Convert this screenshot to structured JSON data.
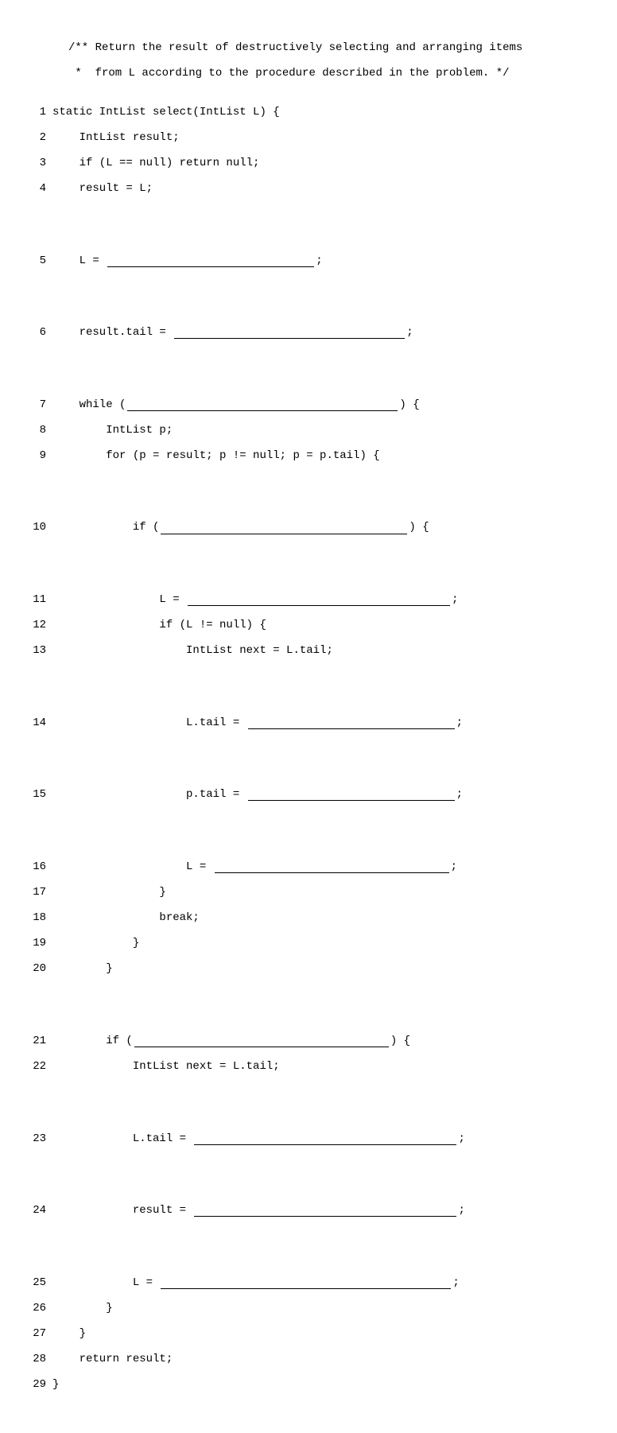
{
  "comment1": "/** Return the result of destructively selecting and arranging items",
  "comment2": " *  from L according to the procedure described in the problem. */",
  "l1": {
    "n": "1",
    "c": "static IntList select(IntList L) {"
  },
  "l2": {
    "n": "2",
    "c": "    IntList result;"
  },
  "l3": {
    "n": "3",
    "c": "    if (L == null) return null;"
  },
  "l4": {
    "n": "4",
    "c": "    result = L;"
  },
  "l5": {
    "n": "5",
    "pre": "    L = ",
    "blank": 260,
    "post": ";"
  },
  "l6": {
    "n": "6",
    "pre": "    result.tail = ",
    "blank": 290,
    "post": ";"
  },
  "l7": {
    "n": "7",
    "pre": "    while (",
    "blank": 340,
    "post": ") {"
  },
  "l8": {
    "n": "8",
    "c": "        IntList p;"
  },
  "l9": {
    "n": "9",
    "c": "        for (p = result; p != null; p = p.tail) {"
  },
  "l10": {
    "n": "10",
    "pre": "            if (",
    "blank": 310,
    "post": ") {"
  },
  "l11": {
    "n": "11",
    "pre": "                L = ",
    "blank": 330,
    "post": ";"
  },
  "l12": {
    "n": "12",
    "c": "                if (L != null) {"
  },
  "l13": {
    "n": "13",
    "c": "                    IntList next = L.tail;"
  },
  "l14": {
    "n": "14",
    "pre": "                    L.tail = ",
    "blank": 260,
    "post": ";"
  },
  "l15": {
    "n": "15",
    "pre": "                    p.tail = ",
    "blank": 260,
    "post": ";"
  },
  "l16": {
    "n": "16",
    "pre": "                    L = ",
    "blank": 295,
    "post": ";"
  },
  "l17": {
    "n": "17",
    "c": "                }"
  },
  "l18": {
    "n": "18",
    "c": "                break;"
  },
  "l19": {
    "n": "19",
    "c": "            }"
  },
  "l20": {
    "n": "20",
    "c": "        }"
  },
  "l21": {
    "n": "21",
    "pre": "        if (",
    "blank": 320,
    "post": ") {"
  },
  "l22": {
    "n": "22",
    "c": "            IntList next = L.tail;"
  },
  "l23": {
    "n": "23",
    "pre": "            L.tail = ",
    "blank": 330,
    "post": ";"
  },
  "l24": {
    "n": "24",
    "pre": "            result = ",
    "blank": 330,
    "post": ";"
  },
  "l25": {
    "n": "25",
    "pre": "            L = ",
    "blank": 365,
    "post": ";"
  },
  "l26": {
    "n": "26",
    "c": "        }"
  },
  "l27": {
    "n": "27",
    "c": "    }"
  },
  "l28": {
    "n": "28",
    "c": "    return result;"
  },
  "l29": {
    "n": "29",
    "c": "}"
  }
}
